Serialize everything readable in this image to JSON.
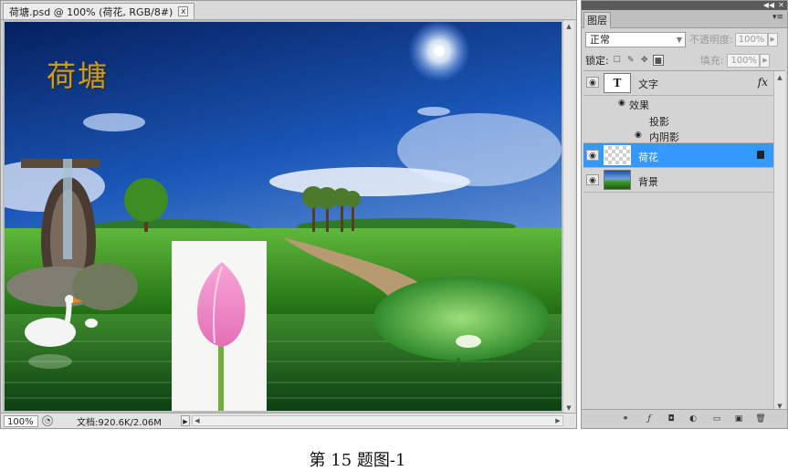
{
  "document": {
    "tab_title": "荷塘.psd @ 100% (荷花, RGB/8#)",
    "tab_close": "x",
    "canvas_text": "荷塘",
    "zoom": "100%",
    "doc_size": "文档:920.6K/2.06M"
  },
  "layers_panel": {
    "tab": "图层",
    "blend_mode": "正常",
    "opacity_label": "不透明度:",
    "opacity_value": "100%",
    "lock_label": "锁定:",
    "fill_label": "填充:",
    "fill_value": "100%",
    "layers": [
      {
        "name": "文字",
        "thumb": "T",
        "fx": "fx"
      },
      {
        "name": "效果"
      },
      {
        "name": "投影"
      },
      {
        "name": "内阴影"
      },
      {
        "name": "荷花"
      },
      {
        "name": "背景"
      }
    ]
  },
  "caption": "第 15 题图-1",
  "icons": [
    "close-icon",
    "eye-icon",
    "lock-icon",
    "brush-icon",
    "move-icon",
    "link-icon",
    "fx-icon",
    "mask-icon",
    "adjustment-icon",
    "folder-icon",
    "new-layer-icon",
    "trash-icon",
    "panel-menu-icon",
    "collapse-icon"
  ],
  "colors": {
    "selected_layer": "#3399ff",
    "sky_top": "#0a2a7a",
    "grass": "#3f9a1f"
  }
}
